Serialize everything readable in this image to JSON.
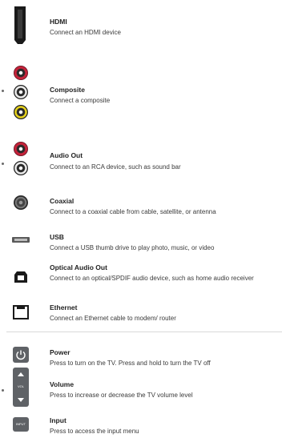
{
  "connections": [
    {
      "title": "HDMI",
      "desc": "Connect an HDMI device"
    },
    {
      "title": "Composite",
      "desc": "Connect a composite"
    },
    {
      "title": "Audio Out",
      "desc": "Connect to an RCA device, such as sound bar"
    },
    {
      "title": "Coaxial",
      "desc": "Connect to a coaxial cable from cable, satellite, or antenna"
    },
    {
      "title": "USB",
      "desc": "Connect a USB thumb drive to play photo, music, or video"
    },
    {
      "title": "Optical Audio Out",
      "desc": "Connect to an optical/SPDIF audio device, such as home audio receiver"
    },
    {
      "title": "Ethernet",
      "desc": "Connect an Ethernet cable to modem/ router"
    }
  ],
  "buttons": [
    {
      "title": "Power",
      "desc": "Press to turn on the TV. Press and hold to turn the TV off"
    },
    {
      "title": "Volume",
      "desc": "Press to increase or decrease the TV volume level",
      "icon_label": "VOL"
    },
    {
      "title": "Input",
      "desc": "Press to access the input menu",
      "icon_label": "INPUT"
    }
  ],
  "colors": {
    "rca_red": "#c4233a",
    "rca_white": "#eaeaea",
    "rca_yellow": "#e6d21e",
    "button_gray": "#5f6266",
    "text": "#2b2b2b"
  }
}
